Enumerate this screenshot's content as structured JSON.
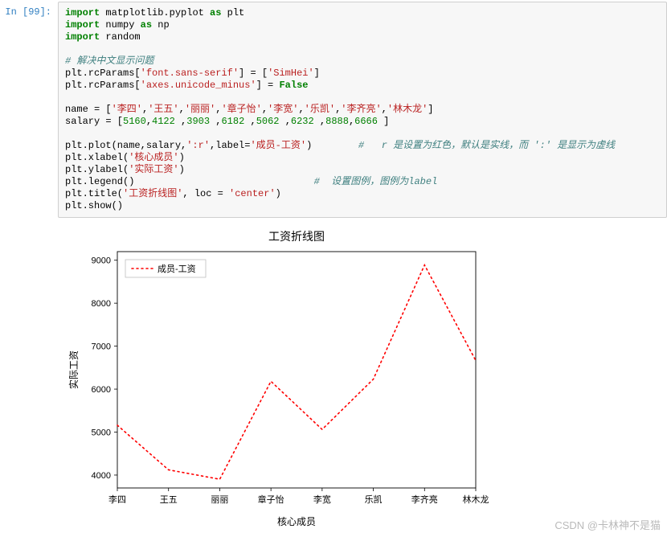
{
  "prompt": {
    "label": "In  [99]:"
  },
  "code": {
    "lines": [
      [
        [
          "kw",
          "import"
        ],
        [
          "nn",
          " matplotlib.pyplot "
        ],
        [
          "kw",
          "as"
        ],
        [
          "nn",
          " plt"
        ]
      ],
      [
        [
          "kw",
          "import"
        ],
        [
          "nn",
          " numpy "
        ],
        [
          "kw",
          "as"
        ],
        [
          "nn",
          " np"
        ]
      ],
      [
        [
          "kw",
          "import"
        ],
        [
          "nn",
          " random"
        ]
      ],
      [
        [
          "nn",
          ""
        ]
      ],
      [
        [
          "cmt",
          "# 解决中文显示问题"
        ]
      ],
      [
        [
          "nn",
          "plt.rcParams["
        ],
        [
          "str",
          "'font.sans-serif'"
        ],
        [
          "nn",
          "] = ["
        ],
        [
          "str",
          "'SimHei'"
        ],
        [
          "nn",
          "]"
        ]
      ],
      [
        [
          "nn",
          "plt.rcParams["
        ],
        [
          "str",
          "'axes.unicode_minus'"
        ],
        [
          "nn",
          "] = "
        ],
        [
          "bool",
          "False"
        ]
      ],
      [
        [
          "nn",
          ""
        ]
      ],
      [
        [
          "nn",
          "name = ["
        ],
        [
          "str",
          "'李四'"
        ],
        [
          "nn",
          ","
        ],
        [
          "str",
          "'王五'"
        ],
        [
          "nn",
          ","
        ],
        [
          "str",
          "'丽丽'"
        ],
        [
          "nn",
          ","
        ],
        [
          "str",
          "'章子怡'"
        ],
        [
          "nn",
          ","
        ],
        [
          "str",
          "'李宽'"
        ],
        [
          "nn",
          ","
        ],
        [
          "str",
          "'乐凯'"
        ],
        [
          "nn",
          ","
        ],
        [
          "str",
          "'李齐亮'"
        ],
        [
          "nn",
          ","
        ],
        [
          "str",
          "'林木龙'"
        ],
        [
          "nn",
          "]"
        ]
      ],
      [
        [
          "nn",
          "salary = ["
        ],
        [
          "num",
          "5160"
        ],
        [
          "nn",
          ","
        ],
        [
          "num",
          "4122"
        ],
        [
          "nn",
          " ,"
        ],
        [
          "num",
          "3903"
        ],
        [
          "nn",
          " ,"
        ],
        [
          "num",
          "6182"
        ],
        [
          "nn",
          " ,"
        ],
        [
          "num",
          "5062"
        ],
        [
          "nn",
          " ,"
        ],
        [
          "num",
          "6232"
        ],
        [
          "nn",
          " ,"
        ],
        [
          "num",
          "8888"
        ],
        [
          "nn",
          ","
        ],
        [
          "num",
          "6666"
        ],
        [
          "nn",
          " ]"
        ]
      ],
      [
        [
          "nn",
          ""
        ]
      ],
      [
        [
          "nn",
          "plt.plot(name,salary,"
        ],
        [
          "str",
          "':r'"
        ],
        [
          "nn",
          ",label="
        ],
        [
          "str",
          "'成员-工资'"
        ],
        [
          "nn",
          ")        "
        ],
        [
          "cmt",
          "#   r 是设置为红色，默认是实线，而 ':' 是显示为虚线"
        ]
      ],
      [
        [
          "nn",
          "plt.xlabel("
        ],
        [
          "str",
          "'核心成员'"
        ],
        [
          "nn",
          ")"
        ]
      ],
      [
        [
          "nn",
          "plt.ylabel("
        ],
        [
          "str",
          "'实际工资'"
        ],
        [
          "nn",
          ")"
        ]
      ],
      [
        [
          "nn",
          "plt.legend()                               "
        ],
        [
          "cmt",
          "#  设置图例，图例为label"
        ]
      ],
      [
        [
          "nn",
          "plt.title("
        ],
        [
          "str",
          "'工资折线图'"
        ],
        [
          "nn",
          ", loc = "
        ],
        [
          "str",
          "'center'"
        ],
        [
          "nn",
          ")"
        ]
      ],
      [
        [
          "nn",
          "plt.show()"
        ]
      ]
    ]
  },
  "chart_data": {
    "type": "line",
    "title": "工资折线图",
    "xlabel": "核心成员",
    "ylabel": "实际工资",
    "categories": [
      "李四",
      "王五",
      "丽丽",
      "章子怡",
      "李宽",
      "乐凯",
      "李齐亮",
      "林木龙"
    ],
    "series": [
      {
        "name": "成员-工资",
        "values": [
          5160,
          4122,
          3903,
          6182,
          5062,
          6232,
          8888,
          6666
        ],
        "style": "dotted",
        "color": "#ff0000"
      }
    ],
    "yticks": [
      4000,
      5000,
      6000,
      7000,
      8000,
      9000
    ],
    "ylim": [
      3700,
      9200
    ],
    "legend_position": "upper-left"
  },
  "watermark": "CSDN @卡林神不是猫"
}
